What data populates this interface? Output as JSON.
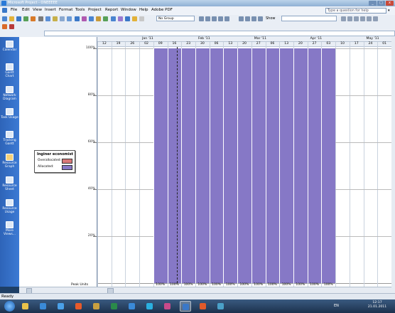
{
  "window": {
    "title": "Microsoft Project - ONEEEEE",
    "min": "_",
    "max": "□",
    "close": "x"
  },
  "menu": {
    "items": [
      "File",
      "Edit",
      "View",
      "Insert",
      "Format",
      "Tools",
      "Project",
      "Report",
      "Window",
      "Help",
      "Adobe PDF"
    ],
    "help_placeholder": "Type a question for help"
  },
  "toolbar": {
    "group": "No Group",
    "show": "Show"
  },
  "viewbar": {
    "items": [
      {
        "label": "Calendar",
        "icon": "calendar-icon"
      },
      {
        "label": "Gantt Chart",
        "icon": "gantt-chart-icon"
      },
      {
        "label": "Network Diagram",
        "icon": "network-diagram-icon"
      },
      {
        "label": "Task Usage",
        "icon": "task-usage-icon"
      },
      {
        "label": "Tracking Gantt",
        "icon": "tracking-gantt-icon"
      },
      {
        "label": "Resource Graph",
        "icon": "resource-graph-icon",
        "active": true
      },
      {
        "label": "Resource Sheet",
        "icon": "resource-sheet-icon"
      },
      {
        "label": "Resource Usage",
        "icon": "resource-usage-icon"
      },
      {
        "label": "More Views...",
        "icon": "more-views-icon"
      }
    ]
  },
  "legend": {
    "title": "Inginer economist",
    "items": [
      {
        "label": "Overallocated:",
        "color": "#d87878"
      },
      {
        "label": "Allocated:",
        "color": "#8678c6"
      }
    ]
  },
  "chart_data": {
    "type": "bar",
    "title": "",
    "ylabel": "",
    "y_ticks": [
      "100%",
      "80%",
      "60%",
      "40%",
      "20%"
    ],
    "ylim": [
      0,
      100
    ],
    "months": [
      "Jan '11",
      "Feb '11",
      "Mar '11",
      "Apr '11",
      "May '11"
    ],
    "weeks": [
      "12",
      "19",
      "26",
      "02",
      "09",
      "16",
      "23",
      "30",
      "06",
      "13",
      "20",
      "27",
      "06",
      "13",
      "20",
      "27",
      "03",
      "10",
      "17",
      "24",
      "01"
    ],
    "series": [
      {
        "name": "Allocated",
        "values": [
          0,
          0,
          0,
          0,
          100,
          100,
          100,
          100,
          100,
          100,
          100,
          100,
          100,
          100,
          100,
          100,
          100,
          0,
          0,
          0,
          0
        ]
      }
    ],
    "peak_units_label": "Peak Units",
    "peak_units": [
      "",
      "",
      "",
      "",
      "100%",
      "100%",
      "100%",
      "100%",
      "100%",
      "100%",
      "100%",
      "100%",
      "100%",
      "100%",
      "100%",
      "100%",
      "100%",
      "",
      "",
      "",
      ""
    ]
  },
  "status": {
    "text": "Ready"
  },
  "taskbar": {
    "lang": "EN",
    "time": "12:17",
    "date": "21.01.2011"
  }
}
